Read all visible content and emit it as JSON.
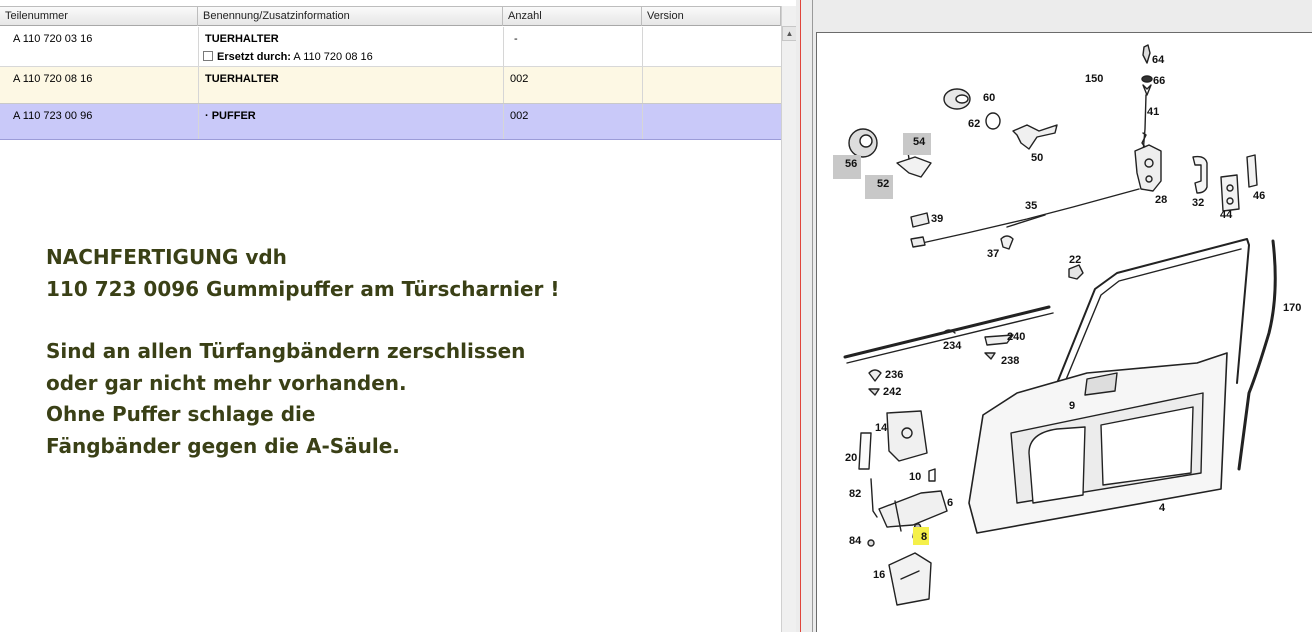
{
  "table": {
    "headers": [
      "Teilenummer",
      "Benennung/Zusatzinformation",
      "Anzahl",
      "Version"
    ],
    "rows": [
      {
        "part_no": "A 110 720 03 16",
        "name": "TUERHALTER",
        "qty": "-",
        "version": "",
        "replaced_label": "Ersetzt durch:",
        "replaced_value": "A 110 720 08 16"
      },
      {
        "part_no": "A 110 720 08 16",
        "name": "TUERHALTER",
        "qty": "002",
        "version": ""
      },
      {
        "part_no": "A 110 723 00 96",
        "name": "· PUFFER",
        "qty": "002",
        "version": ""
      }
    ]
  },
  "note": {
    "lines": [
      "NACHFERTIGUNG vdh",
      "110 723 0096 Gummipuffer am Türscharnier !",
      "",
      "Sind an allen Türfangbändern zerschlissen",
      "oder gar nicht mehr vorhanden.",
      "Ohne Puffer schlage die",
      "Fängbänder gegen die A-Säule."
    ],
    "color": "#3a4016"
  },
  "diagram": {
    "part_labels": [
      "64",
      "150",
      "66",
      "60",
      "41",
      "62",
      "50",
      "54",
      "56",
      "52",
      "28",
      "32",
      "46",
      "44",
      "35",
      "39",
      "37",
      "22",
      "170",
      "240",
      "234",
      "238",
      "236",
      "242",
      "9",
      "14",
      "20",
      "10",
      "82",
      "6",
      "84",
      "8",
      "4",
      "16"
    ],
    "highlight_label": "8",
    "highlight_color": "#f5f04a"
  }
}
